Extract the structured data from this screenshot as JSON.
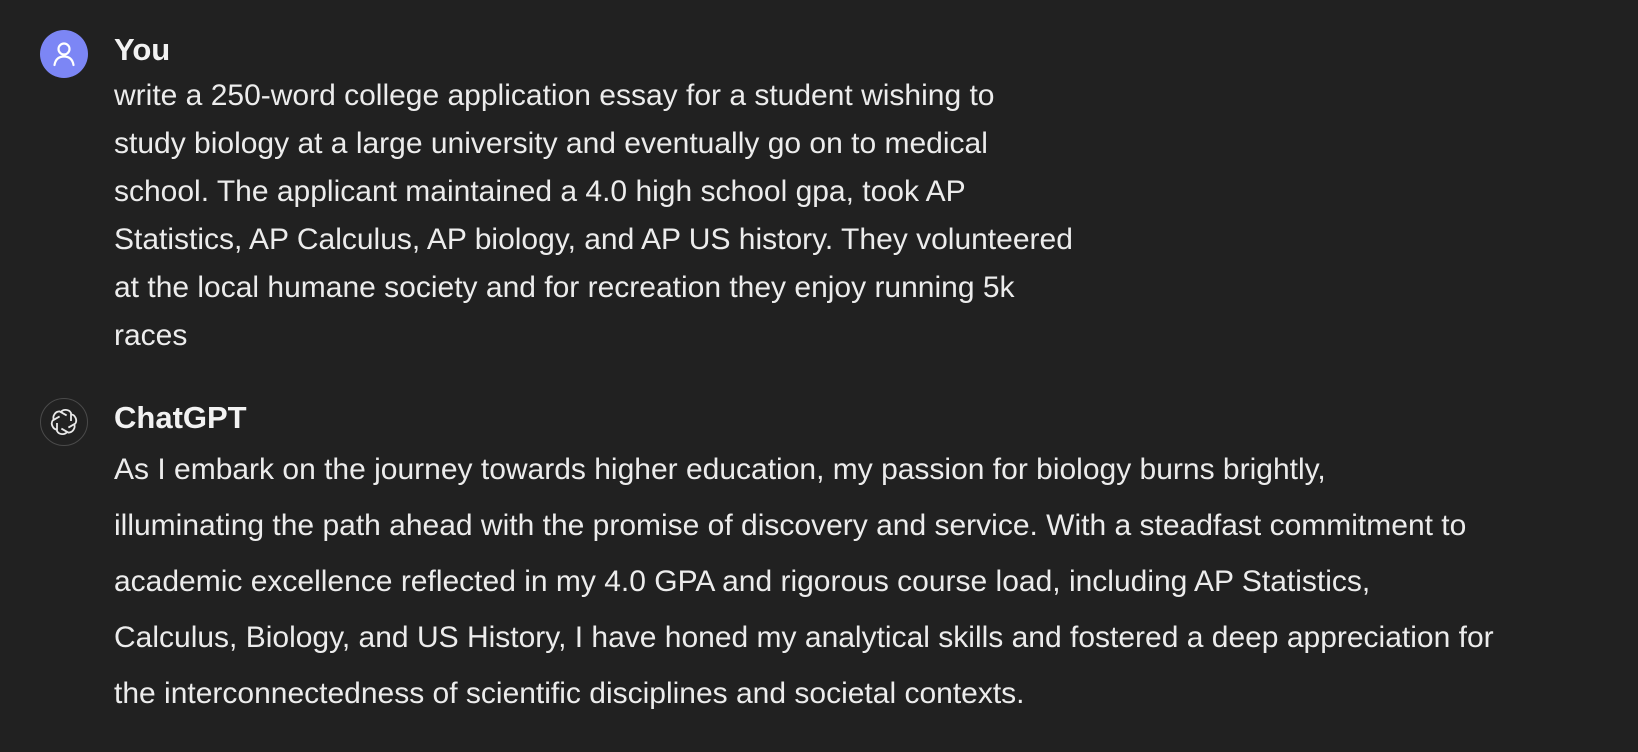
{
  "conversation": {
    "messages": [
      {
        "author": "You",
        "avatar_icon": "user-icon",
        "avatar_color": "#7c86f5",
        "text": "write a 250-word college application essay for a student wishing to\nstudy biology at a large university and eventually go on to medical\nschool. The applicant maintained a 4.0 high school gpa, took AP\nStatistics, AP Calculus, AP biology, and AP US history. They volunteered\nat the local humane society and for recreation they enjoy running 5k\nraces"
      },
      {
        "author": "ChatGPT",
        "avatar_icon": "openai-logo-icon",
        "text": "As I embark on the journey towards higher education, my passion for biology burns brightly,\nilluminating the path ahead with the promise of discovery and service. With a steadfast commitment to\nacademic excellence reflected in my 4.0 GPA and rigorous course load, including AP Statistics,\nCalculus, Biology, and US History, I have honed my analytical skills and fostered a deep appreciation for\nthe interconnectedness of scientific disciplines and societal contexts."
      }
    ]
  },
  "theme": {
    "background": "#212121",
    "text_color": "#ececec"
  }
}
